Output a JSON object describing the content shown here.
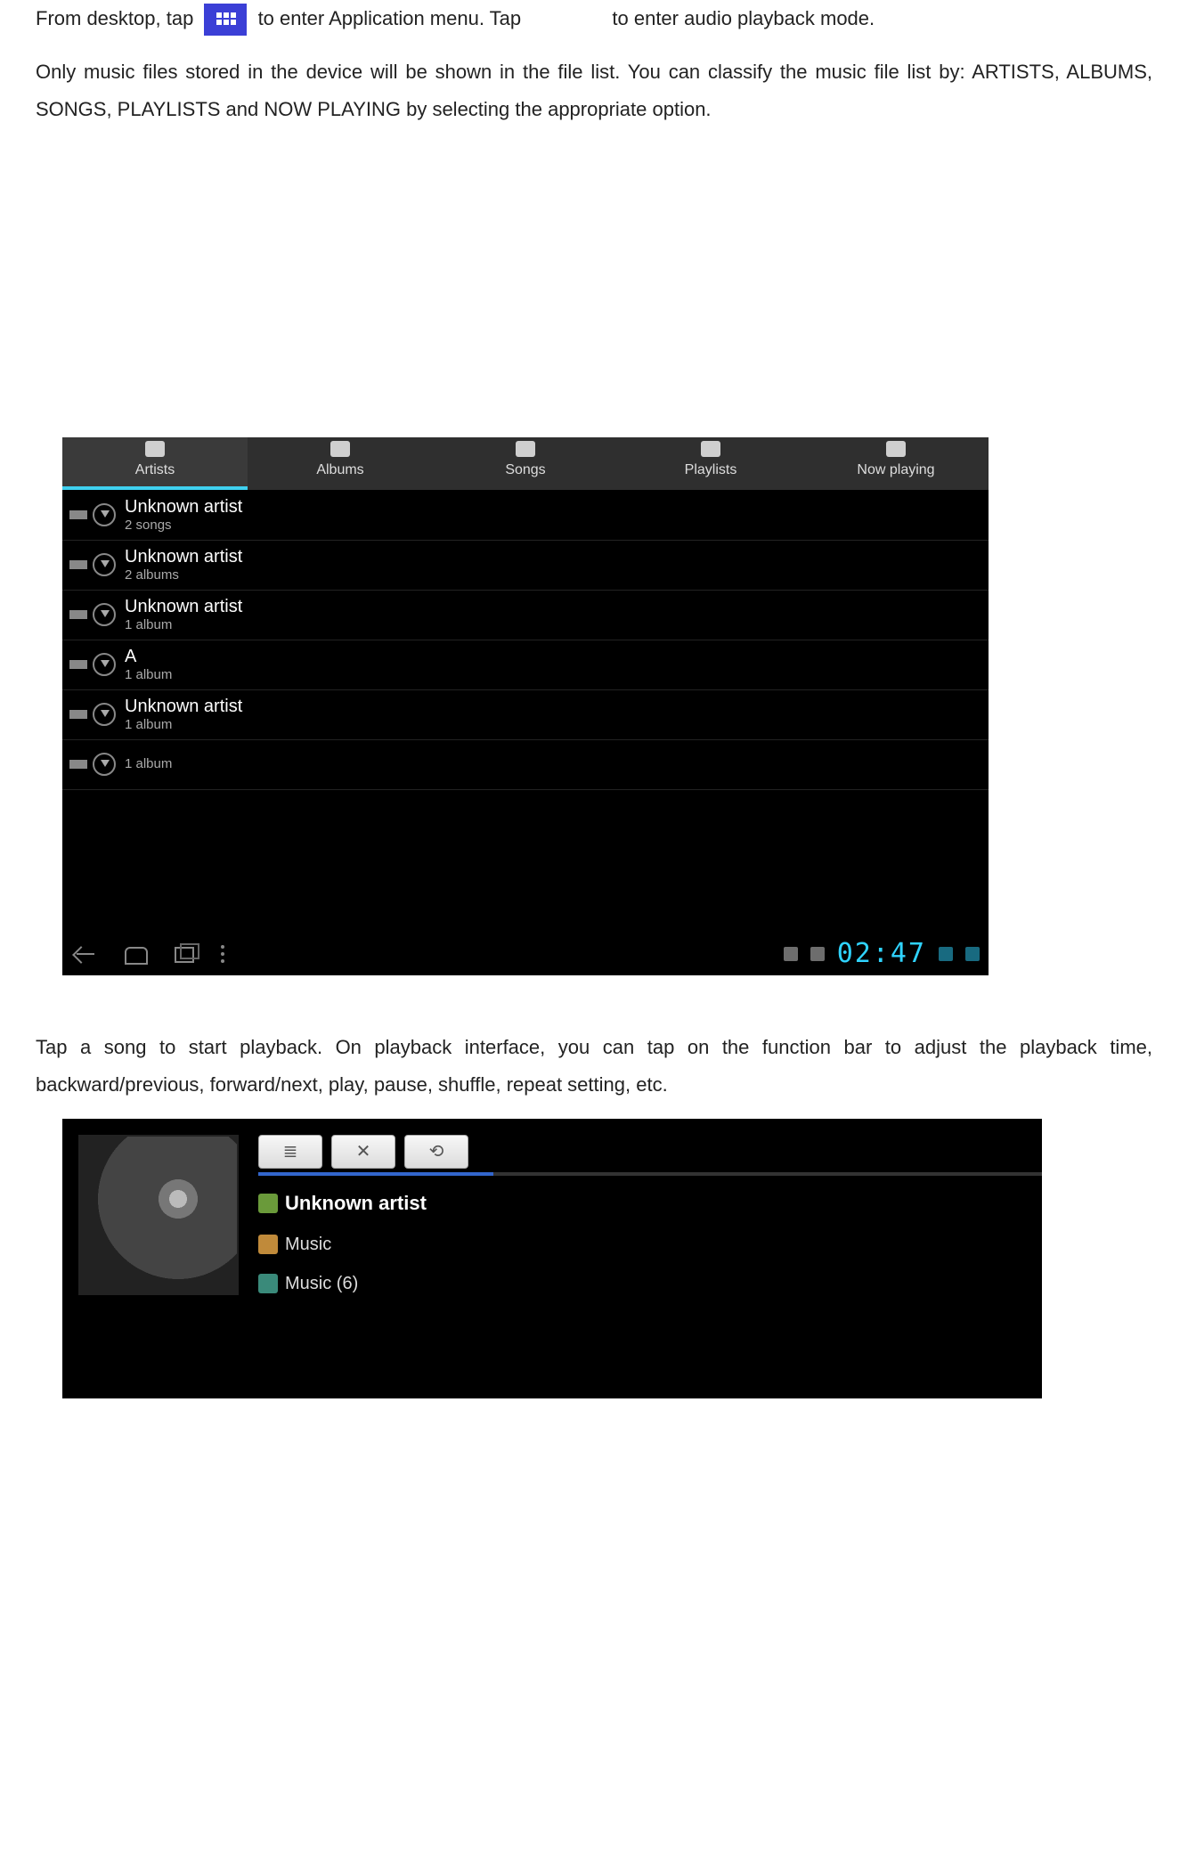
{
  "intro": {
    "part1": "From desktop, tap",
    "part2": "to enter Application menu.  Tap",
    "part3": "to enter audio playback mode.",
    "line2": "Only music files stored in the device will be shown in the file list.   You can classify the music file list by: ARTISTS, ALBUMS, SONGS, PLAYLISTS and NOW PLAYING by selecting the appropriate option."
  },
  "tabs": [
    {
      "label": "Artists",
      "active": true
    },
    {
      "label": "Albums",
      "active": false
    },
    {
      "label": "Songs",
      "active": false
    },
    {
      "label": "Playlists",
      "active": false
    },
    {
      "label": "Now playing",
      "active": false
    }
  ],
  "artists": [
    {
      "title": "Unknown artist",
      "sub": "2 songs"
    },
    {
      "title": "Unknown artist",
      "sub": "2 albums"
    },
    {
      "title": "Unknown artist",
      "sub": "1 album"
    },
    {
      "title": "A",
      "sub": "1 album"
    },
    {
      "title": "Unknown artist",
      "sub": "1 album"
    },
    {
      "title": "",
      "sub": "1 album"
    }
  ],
  "navbar": {
    "clock": "02:47"
  },
  "mid_text": "Tap a song to start playback.   On playback interface, you can tap on the function bar to adjust the playback time, backward/previous, forward/next, play, pause, shuffle, repeat setting, etc.",
  "nowplaying": {
    "buttons": {
      "queue": "≣",
      "shuffle": "✕",
      "repeat": "⟲"
    },
    "artist": "Unknown artist",
    "album": "Music",
    "track": "Music (6)"
  }
}
